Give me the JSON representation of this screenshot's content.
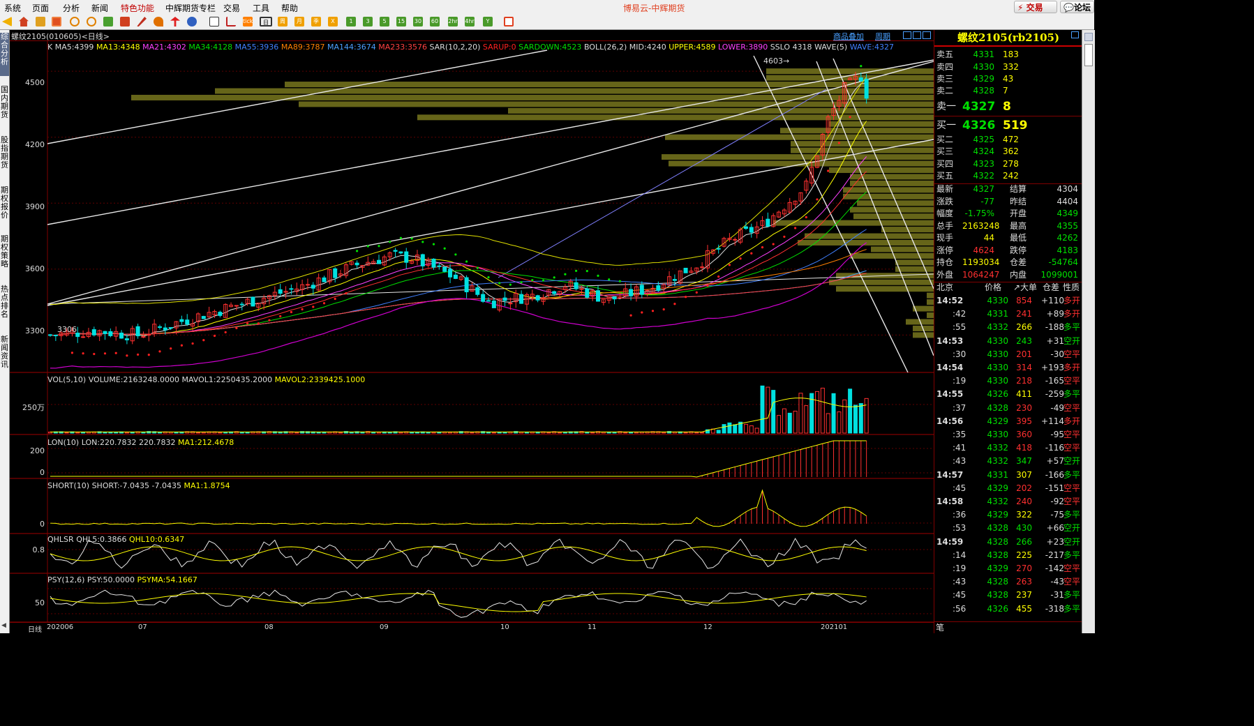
{
  "menubar": {
    "items": [
      "系统",
      "页面",
      "分析",
      "新闻",
      "特色功能",
      "中辉期货专栏",
      "交易",
      "工具",
      "帮助"
    ],
    "app_title": "博易云-中辉期货",
    "trade_button": "交易",
    "forum_button": "论坛"
  },
  "toolbar": {
    "icons": [
      "back-icon",
      "home-icon",
      "folder-icon",
      "quote-table-icon",
      "search-icon",
      "window-icon",
      "pen-icon",
      "draw-icon",
      "marker-icon",
      "indicator-icon",
      "list-icon",
      "line-chart-icon",
      "tick-icon",
      "day-icon",
      "week-icon",
      "month-icon",
      "season-icon",
      "year-icon",
      "min1-icon",
      "min5-icon",
      "min15-icon",
      "min30-icon",
      "min60-icon",
      "hour2-icon",
      "hour4-icon",
      "custom-period-icon",
      "calc-icon"
    ],
    "period_labels": {
      "tick": "tick",
      "day": "日",
      "week": "周",
      "month": "月",
      "season": "季",
      "year": "X",
      "m1": "1",
      "m3": "3",
      "m5": "5",
      "m15": "15",
      "m30": "30",
      "m60": "60",
      "h2": "2hr",
      "h4": "4hr",
      "ym": "Y"
    }
  },
  "side_tabs": [
    "综合分析",
    "国内期货",
    "股指期货",
    "期权报价",
    "期权策略",
    "热点排名",
    "新闻资讯"
  ],
  "chart": {
    "title": "螺纹2105(010605)<日线>",
    "links": [
      "商品叠加",
      "周期"
    ],
    "legend_main": [
      {
        "t": "K",
        "c": "#ddd"
      },
      {
        "t": "MA5:4399",
        "c": "#ddd"
      },
      {
        "t": "MA13:4348",
        "c": "#ffff00"
      },
      {
        "t": "MA21:4302",
        "c": "#ff40ff"
      },
      {
        "t": "MA34:4128",
        "c": "#00e000"
      },
      {
        "t": "MA55:3936",
        "c": "#4080ff"
      },
      {
        "t": "MA89:3787",
        "c": "#ff8000"
      },
      {
        "t": "MA144:3674",
        "c": "#4aa0ff"
      },
      {
        "t": "MA233:3576",
        "c": "#ff4040"
      },
      {
        "t": "SAR(10,2,20)",
        "c": "#ddd"
      },
      {
        "t": "SARUP:0",
        "c": "#ff2020"
      },
      {
        "t": "SARDOWN:4523",
        "c": "#00e000"
      },
      {
        "t": "BOLL(26,2)",
        "c": "#ddd"
      },
      {
        "t": "MID:4240",
        "c": "#ddd"
      },
      {
        "t": "UPPER:4589",
        "c": "#ffff00"
      },
      {
        "t": "LOWER:3890",
        "c": "#ff40ff"
      },
      {
        "t": "SSLO",
        "c": "#ddd"
      },
      {
        "t": "4318",
        "c": "#ddd"
      },
      {
        "t": "WAVE(5)",
        "c": "#ddd"
      },
      {
        "t": "WAVE:4327",
        "c": "#4080ff"
      }
    ],
    "y_ticks": [
      "4500",
      "4200",
      "3900",
      "3600",
      "3300"
    ],
    "price_range": [
      3130,
      4640
    ],
    "high_label": "4603",
    "low_label": "3306",
    "panels": {
      "volume": {
        "legend": [
          {
            "t": "VOL(5,10)",
            "c": "#ddd"
          },
          {
            "t": "VOLUME:2163248.0000",
            "c": "#ddd"
          },
          {
            "t": "MAVOL1:2250435.2000",
            "c": "#ddd"
          },
          {
            "t": "MAVOL2:2339425.1000",
            "c": "#ffff00"
          }
        ],
        "ytick": "250万"
      },
      "lon": {
        "legend": [
          {
            "t": "LON(10)",
            "c": "#ddd"
          },
          {
            "t": "LON:220.7832",
            "c": "#ddd"
          },
          {
            "t": "220.7832",
            "c": "#ddd"
          },
          {
            "t": "MA1:212.4678",
            "c": "#ffff00"
          }
        ],
        "yticks": [
          "200",
          "0"
        ]
      },
      "short": {
        "legend": [
          {
            "t": "SHORT(10)",
            "c": "#ddd"
          },
          {
            "t": "SHORT:-7.0435",
            "c": "#ddd"
          },
          {
            "t": "-7.0435",
            "c": "#ddd"
          },
          {
            "t": "MA1:1.8754",
            "c": "#ffff00"
          }
        ],
        "ytick": "0"
      },
      "qhlsr": {
        "legend": [
          {
            "t": "QHLSR",
            "c": "#ddd"
          },
          {
            "t": "QHL5:0.3866",
            "c": "#ddd"
          },
          {
            "t": "QHL10:0.6347",
            "c": "#ffff00"
          }
        ],
        "ytick": "0.8"
      },
      "psy": {
        "legend": [
          {
            "t": "PSY(12,6)",
            "c": "#ddd"
          },
          {
            "t": "PSY:50.0000",
            "c": "#ddd"
          },
          {
            "t": "PSYMA:54.1667",
            "c": "#ffff00"
          }
        ],
        "ytick": "50"
      }
    },
    "period_label": "日线",
    "x_labels": [
      "202006",
      "07",
      "08",
      "09",
      "10",
      "11",
      "12",
      "202101"
    ]
  },
  "quote": {
    "title": "螺纹2105(rb2105)",
    "asks": [
      [
        "卖五",
        "4331",
        "183"
      ],
      [
        "卖四",
        "4330",
        "332"
      ],
      [
        "卖三",
        "4329",
        "43"
      ],
      [
        "卖二",
        "4328",
        "7"
      ],
      [
        "卖一",
        "4327",
        "8"
      ]
    ],
    "bids": [
      [
        "买一",
        "4326",
        "519"
      ],
      [
        "买二",
        "4325",
        "472"
      ],
      [
        "买三",
        "4324",
        "362"
      ],
      [
        "买四",
        "4323",
        "278"
      ],
      [
        "买五",
        "4322",
        "242"
      ]
    ],
    "stats": [
      [
        "最新",
        "4327",
        "结算",
        "4304"
      ],
      [
        "涨跌",
        "-77",
        "昨结",
        "4404"
      ],
      [
        "幅度",
        "-1.75%",
        "开盘",
        "4349"
      ],
      [
        "总手",
        "2163248",
        "最高",
        "4355"
      ],
      [
        "现手",
        "44",
        "最低",
        "4262"
      ],
      [
        "涨停",
        "4624",
        "跌停",
        "4183"
      ],
      [
        "持仓",
        "1193034",
        "仓差",
        "-54764"
      ],
      [
        "外盘",
        "1064247",
        "内盘",
        "1099001"
      ]
    ],
    "tick_header": [
      "北京",
      "价格",
      "↗大单",
      "仓差",
      "性质"
    ],
    "ticks": [
      [
        "14:52",
        "4330",
        "854",
        "+110",
        "多开"
      ],
      [
        ":42",
        "4331",
        "241",
        "+89",
        "多开"
      ],
      [
        ":55",
        "4332",
        "266",
        "-188",
        "多平"
      ],
      [
        "14:53",
        "4330",
        "243",
        "+31",
        "空开"
      ],
      [
        ":30",
        "4330",
        "201",
        "-30",
        "空平"
      ],
      [
        "14:54",
        "4330",
        "314",
        "+193",
        "多开"
      ],
      [
        ":19",
        "4330",
        "218",
        "-165",
        "空平"
      ],
      [
        "14:55",
        "4326",
        "411",
        "-259",
        "多平"
      ],
      [
        ":37",
        "4328",
        "230",
        "-49",
        "空平"
      ],
      [
        "14:56",
        "4329",
        "395",
        "+114",
        "多开"
      ],
      [
        ":35",
        "4330",
        "360",
        "-95",
        "空平"
      ],
      [
        ":41",
        "4332",
        "418",
        "-116",
        "空平"
      ],
      [
        ":43",
        "4332",
        "347",
        "+57",
        "空开"
      ],
      [
        "14:57",
        "4331",
        "307",
        "-166",
        "多平"
      ],
      [
        ":45",
        "4329",
        "202",
        "-151",
        "空平"
      ],
      [
        "14:58",
        "4332",
        "240",
        "-92",
        "空平"
      ],
      [
        ":36",
        "4329",
        "322",
        "-75",
        "多平"
      ],
      [
        ":53",
        "4328",
        "430",
        "+66",
        "空开"
      ],
      [
        "14:59",
        "4328",
        "266",
        "+23",
        "空开"
      ],
      [
        ":14",
        "4328",
        "225",
        "-217",
        "多平"
      ],
      [
        ":19",
        "4329",
        "270",
        "-142",
        "空平"
      ],
      [
        ":43",
        "4328",
        "263",
        "-43",
        "空平"
      ],
      [
        ":45",
        "4328",
        "237",
        "-31",
        "多平"
      ],
      [
        ":56",
        "4326",
        "455",
        "-318",
        "多平"
      ]
    ],
    "footer": "笔"
  }
}
